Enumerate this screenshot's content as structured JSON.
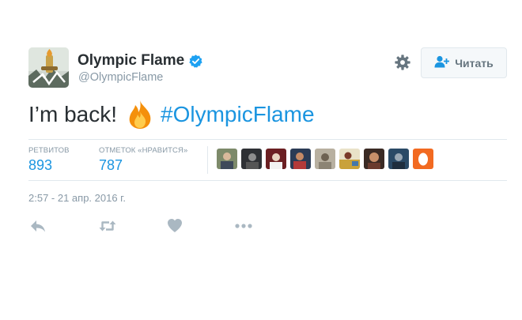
{
  "author": {
    "display_name": "Olympic Flame",
    "handle": "@OlympicFlame",
    "verified": true
  },
  "follow_button": {
    "label": "Читать"
  },
  "tweet": {
    "text_before": "I’m back!",
    "emoji": "fire-emoji",
    "hashtag": "#OlympicFlame"
  },
  "stats": {
    "retweets": {
      "label": "РЕТВИТОВ",
      "value": "893"
    },
    "likes": {
      "label": "ОТМЕТОК «НРАВИТСЯ»",
      "value": "787"
    }
  },
  "likers": [
    {
      "name": "liker-avatar-1"
    },
    {
      "name": "liker-avatar-2"
    },
    {
      "name": "liker-avatar-3"
    },
    {
      "name": "liker-avatar-4"
    },
    {
      "name": "liker-avatar-5"
    },
    {
      "name": "liker-avatar-6"
    },
    {
      "name": "liker-avatar-7"
    },
    {
      "name": "liker-avatar-8"
    },
    {
      "name": "liker-avatar-9"
    }
  ],
  "timestamp": "2:57 - 21 апр. 2016 г.",
  "icons": {
    "verified": "verified-badge-icon",
    "settings": "gear-icon",
    "follow": "add-person-icon",
    "reply": "reply-icon",
    "retweet": "retweet-icon",
    "like": "heart-icon",
    "more": "more-icon"
  },
  "colors": {
    "link": "#1b95e0",
    "muted": "#8899a6",
    "text": "#292f33",
    "border": "#e1e8ed",
    "icon": "#aab8c2"
  }
}
